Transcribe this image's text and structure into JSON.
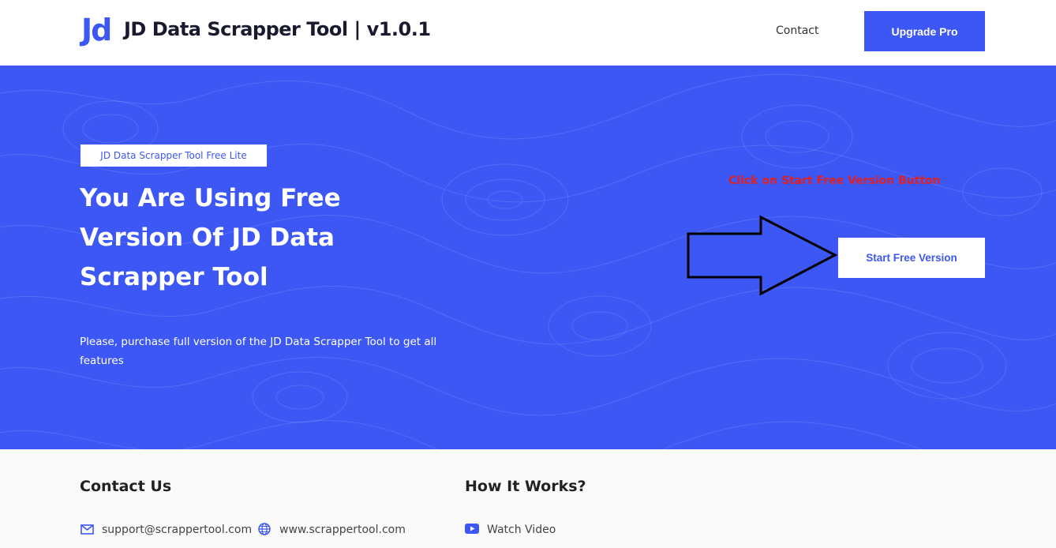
{
  "header": {
    "logo_mark": "Jd",
    "logo_text": "JD Data Scrapper Tool | v1.0.1",
    "nav_contact": "Contact",
    "upgrade_label": "Upgrade Pro"
  },
  "hero": {
    "badge": "JD Data Scrapper Tool Free Lite",
    "title": "You Are Using Free Version Of JD Data Scrapper Tool",
    "description": "Please, purchase full version of the JD Data Scrapper Tool to get all features",
    "annotation": "Click on Start Free Version Button",
    "start_label": "Start Free Version",
    "background_color": "#3d57f5"
  },
  "footer": {
    "contact": {
      "heading": "Contact Us",
      "email": "support@scrappertool.com",
      "website": "www.scrappertool.com"
    },
    "how_it_works": {
      "heading": "How It Works?",
      "watch_video": "Watch Video"
    }
  },
  "icons": [
    "envelope-icon",
    "globe-icon",
    "youtube-play-icon",
    "arrow-right-icon"
  ],
  "colors": {
    "accent": "#3d57f5",
    "annotation": "#e02020"
  }
}
